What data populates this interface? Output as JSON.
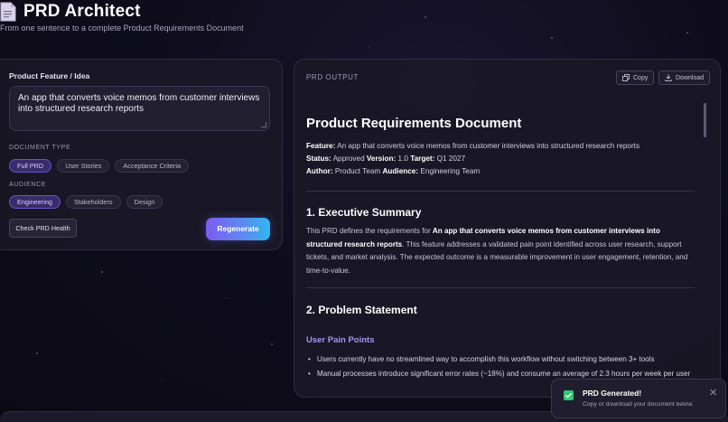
{
  "header": {
    "title": "PRD Architect",
    "subtitle": "From one sentence to a complete Product Requirements Document"
  },
  "input_panel": {
    "field_label": "Product Feature / Idea",
    "idea_value": "An app that converts voice memos from customer interviews into structured research reports",
    "document_type_label": "DOCUMENT TYPE",
    "document_types": [
      {
        "label": "Full PRD",
        "active": true
      },
      {
        "label": "User Stories",
        "active": false
      },
      {
        "label": "Acceptance Criteria",
        "active": false
      }
    ],
    "audience_label": "AUDIENCE",
    "audiences": [
      {
        "label": "Engineering",
        "active": true
      },
      {
        "label": "Stakeholders",
        "active": false
      },
      {
        "label": "Design",
        "active": false
      }
    ],
    "health_button": "Check PRD Health",
    "regenerate_button": "Regenerate"
  },
  "output_panel": {
    "label": "PRD OUTPUT",
    "copy_button": "Copy",
    "download_button": "Download",
    "doc": {
      "title": "Product Requirements Document",
      "feature_key": "Feature:",
      "feature_value": "An app that converts voice memos from customer interviews into structured research reports",
      "status_key": "Status:",
      "status_value": "Approved",
      "version_key": "Version:",
      "version_value": "1.0",
      "target_key": "Target:",
      "target_value": "Q1 2027",
      "author_key": "Author:",
      "author_value": "Product Team",
      "audience_key": "Audience:",
      "audience_value": "Engineering Team",
      "section1_title": "1. Executive Summary",
      "section1_pre": "This PRD defines the requirements for",
      "section1_bold": "An app that converts voice memos from customer interviews into structured research reports",
      "section1_post": ". This feature addresses a validated pain point identified across user research, support tickets, and market analysis. The expected outcome is a measurable improvement in user engagement, retention, and time-to-value.",
      "section2_title": "2. Problem Statement",
      "subsection_title": "User Pain Points",
      "bullets": [
        "Users currently have no streamlined way to accomplish this workflow without switching between 3+ tools",
        "Manual processes introduce significant error rates (~18%) and consume an average of 2.3 hours per week per user"
      ]
    }
  },
  "toast": {
    "title": "PRD Generated!",
    "message": "Copy or download your document below.",
    "close": "✕"
  },
  "colors": {
    "accent": "#7b5cf2",
    "accent_end": "#2fb7f0",
    "success": "#2ec973",
    "subheading": "#a593f3"
  }
}
